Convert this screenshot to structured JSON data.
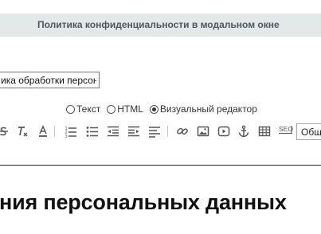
{
  "header": {
    "title": "Политика конфиденциальности в модальном окне"
  },
  "field": {
    "value": "ика обработки персон"
  },
  "mode": {
    "options": [
      {
        "label": "Текст",
        "selected": false
      },
      {
        "label": "HTML",
        "selected": false
      },
      {
        "label": "Визуальный редактор",
        "selected": true
      }
    ]
  },
  "toolbar": {
    "icons": [
      "strikethrough-icon",
      "clear-format-icon",
      "font-color-icon",
      "numbered-list-icon",
      "bullet-list-icon",
      "outdent-icon",
      "indent-icon",
      "align-icon",
      "link-icon",
      "image-icon",
      "video-icon",
      "anchor-icon",
      "table-icon",
      "seo-icon"
    ],
    "seo_label": "SEO",
    "format_value": "Общ"
  },
  "editor": {
    "heading": "ния персональных данных"
  },
  "colors": {
    "header_bg": "#e3e8e8",
    "header_text": "#4a5a5c",
    "icon": "#555555"
  }
}
